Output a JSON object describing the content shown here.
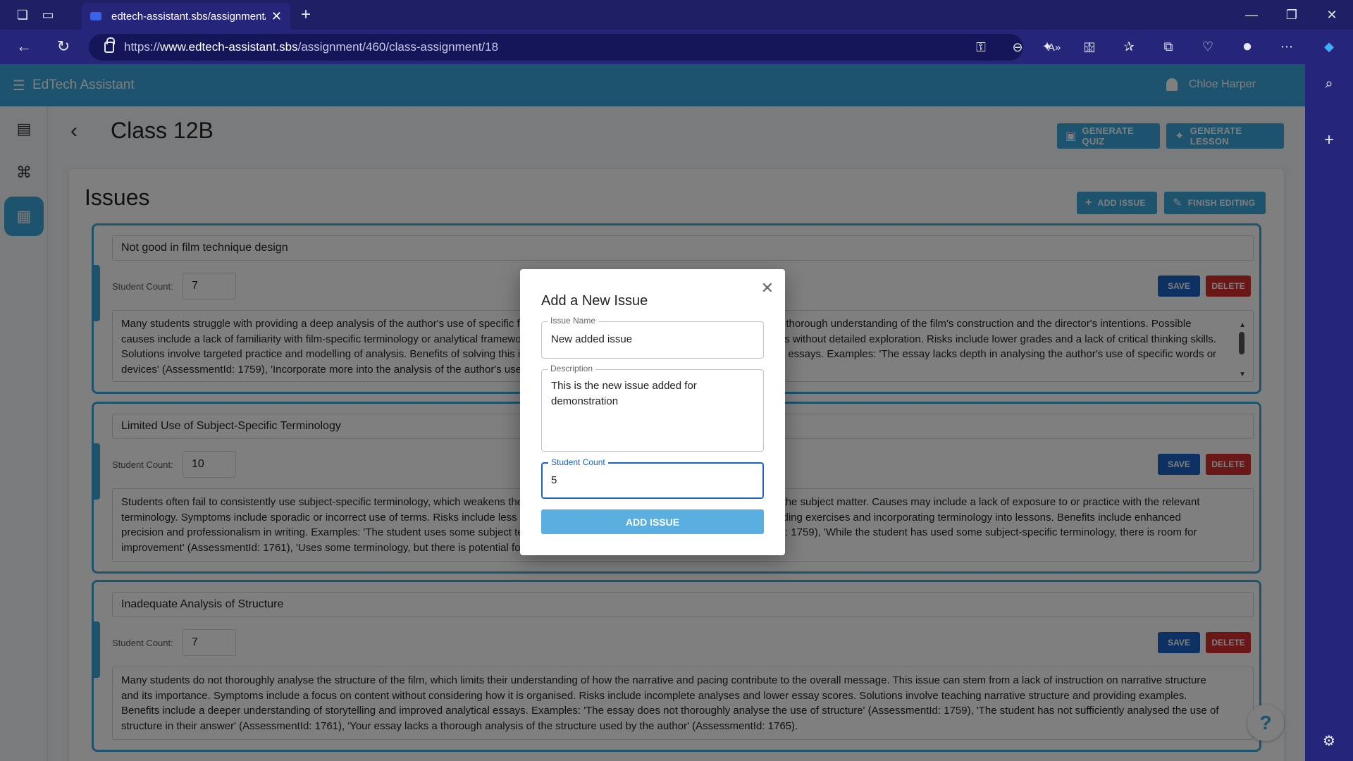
{
  "browser": {
    "tab_title": "edtech-assistant.sbs/assignment/",
    "url_prefix": "https://",
    "url_domain": "www.edtech-assistant.sbs",
    "url_path": "/assignment/460/class-assignment/18"
  },
  "app": {
    "title": "EdTech Assistant",
    "user_name": "Chloe Harper"
  },
  "page": {
    "title": "Class 12B",
    "generate_quiz": "GENERATE QUIZ",
    "generate_lesson": "GENERATE LESSON"
  },
  "issues_section": {
    "title": "Issues",
    "add_issue": "ADD ISSUE",
    "finish_editing": "FINISH EDITING",
    "student_count_label": "Student Count:",
    "save_label": "SAVE",
    "delete_label": "DELETE"
  },
  "issues": [
    {
      "name": "Not good in film technique design",
      "count": "7",
      "description": "Many students struggle with providing a deep analysis of the author's use of specific film techniques, which limits their ability to demonstrate a thorough understanding of the film's construction and the director's intentions. Possible causes include a lack of familiarity with film-specific terminology or analytical frameworks. Symptoms include superficial mentions of techniques without detailed exploration. Risks include lower grades and a lack of critical thinking skills. Solutions involve targeted practice and modelling of analysis. Benefits of solving this issue include improved analytical skills and higher-quality essays. Examples: 'The essay lacks depth in analysing the author's use of specific words or devices' (AssessmentId: 1759), 'Incorporate more into the analysis of the author's use of specific words or devices in the quotations'"
    },
    {
      "name": "Limited Use of Subject-Specific Terminology",
      "count": "10",
      "description": "Students often fail to consistently use subject-specific terminology, which weakens their arguments and fails to demonstrate a strong grasp of the subject matter. Causes may include a lack of exposure to or practice with the relevant terminology. Symptoms include sporadic or incorrect use of terms. Risks include less convincing arguments. Solutions include vocabulary-building exercises and incorporating terminology into lessons. Benefits include enhanced precision and professionalism in writing. Examples: 'The student uses some subject terminology but could improve in this area' (AssessmentId: 1759), 'While the student has used some subject-specific terminology, there is room for improvement' (AssessmentId: 1761), 'Uses some terminology, but there is potential for more' (AssessmentId: 1772)."
    },
    {
      "name": "Inadequate Analysis of Structure",
      "count": "7",
      "description": "Many students do not thoroughly analyse the structure of the film, which limits their understanding of how the narrative and pacing contribute to the overall message. This issue can stem from a lack of instruction on narrative structure and its importance. Symptoms include a focus on content without considering how it is organised. Risks include incomplete analyses and lower essay scores. Solutions involve teaching narrative structure and providing examples. Benefits include a deeper understanding of storytelling and improved analytical essays. Examples: 'The essay does not thoroughly analyse the use of structure' (AssessmentId: 1759), 'The student has not sufficiently analysed the use of structure in their answer' (AssessmentId: 1761), 'Your essay lacks a thorough analysis of the structure used by the author' (AssessmentId: 1765)."
    }
  ],
  "dialog": {
    "title": "Add a New Issue",
    "name_label": "Issue Name",
    "name_value": "New added issue",
    "desc_label": "Description",
    "desc_value": "This is the new issue added for demonstration",
    "count_label": "Student Count",
    "count_value": "5",
    "submit_label": "ADD ISSUE"
  },
  "help_label": "?",
  "colors": {
    "header": "#3aa6d9",
    "save": "#1a62c4",
    "delete": "#d32f2f",
    "browser": "#25257a"
  }
}
